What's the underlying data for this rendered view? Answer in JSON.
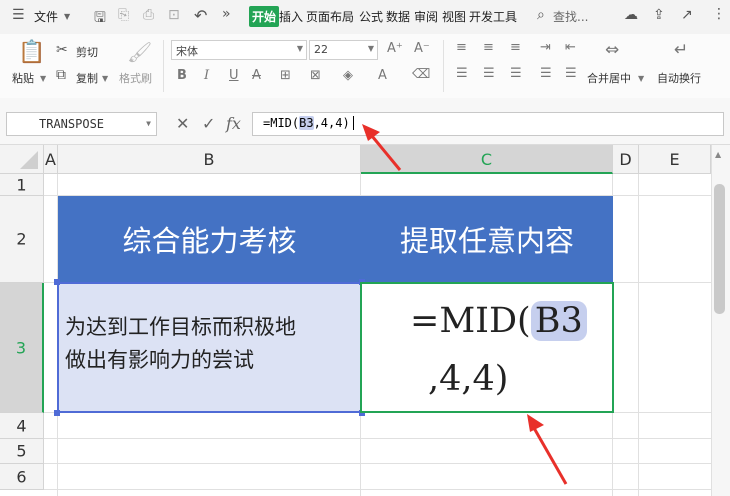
{
  "menu": {
    "file_label": "文件",
    "active_tab": "开始",
    "tabs": [
      "插入",
      "页面布局",
      "公式",
      "数据",
      "审阅",
      "视图",
      "开发工具"
    ],
    "search_label": "查找..."
  },
  "ribbon": {
    "paste_label": "粘贴",
    "cut_label": "剪切",
    "copy_label": "复制",
    "format_painter_label": "格式刷",
    "font_name": "宋体",
    "font_size": "22",
    "merge_center_label": "合并居中",
    "wrap_text_label": "自动换行"
  },
  "formula_bar": {
    "name_box": "TRANSPOSE",
    "fx_label": "fx",
    "formula_prefix": "=MID(",
    "formula_ref": "B3",
    "formula_suffix": ",4,4)"
  },
  "columns": [
    "A",
    "B",
    "C",
    "D",
    "E"
  ],
  "rows": [
    "1",
    "2",
    "3",
    "4",
    "5",
    "6"
  ],
  "cells": {
    "B2": "综合能力考核",
    "C2": "提取任意内容",
    "B3_line1": "为达到工作目标而积极地",
    "B3_line2": "做出有影响力的尝试",
    "C3_prefix": "=MID(",
    "C3_ref": "B3",
    "C3_suffix": ",4,4)"
  },
  "colors": {
    "header_fill": "#4472c4",
    "active_green": "#23a455",
    "arrow_red": "#e8302a",
    "ref_highlight": "#c6cfee"
  }
}
